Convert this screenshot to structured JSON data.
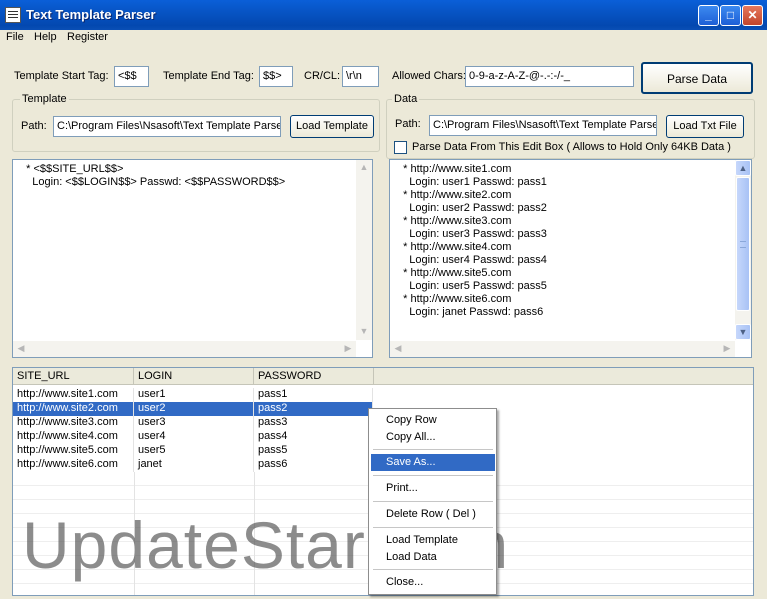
{
  "window": {
    "title": "Text Template Parser"
  },
  "menu": [
    "File",
    "Help",
    "Register"
  ],
  "toolbar": {
    "start_tag_label": "Template Start Tag:",
    "start_tag_value": "<$$",
    "end_tag_label": "Template End Tag:",
    "end_tag_value": "$$>",
    "crcl_label": "CR/CL:",
    "crcl_value": "\\r\\n",
    "allowed_label": "Allowed Chars:",
    "allowed_value": "0-9-a-z-A-Z-@-.-:-/-_",
    "parse_button": "Parse Data"
  },
  "template_panel": {
    "group_label": "Template",
    "path_label": "Path:",
    "path_value": "C:\\Program Files\\Nsasoft\\Text Template Parse",
    "load_button": "Load Template",
    "lines": [
      "   * <$$SITE_URL$$>",
      "     Login: <$$LOGIN$$> Passwd: <$$PASSWORD$$>"
    ]
  },
  "data_panel": {
    "group_label": "Data",
    "path_label": "Path:",
    "path_value": "C:\\Program Files\\Nsasoft\\Text Template Parse",
    "load_button": "Load Txt File",
    "checkbox_label": "Parse Data From This Edit Box ( Allows to Hold Only 64KB Data )",
    "checkbox_checked": false,
    "lines": [
      "   * http://www.site1.com",
      "     Login: user1 Passwd: pass1",
      "   * http://www.site2.com",
      "     Login: user2 Passwd: pass2",
      "   * http://www.site3.com",
      "     Login: user3 Passwd: pass3",
      "   * http://www.site4.com",
      "     Login: user4 Passwd: pass4",
      "   * http://www.site5.com",
      "     Login: user5 Passwd: pass5",
      "   * http://www.site6.com",
      "     Login: janet Passwd: pass6"
    ]
  },
  "results": {
    "columns": [
      "SITE_URL",
      "LOGIN",
      "PASSWORD"
    ],
    "rows": [
      [
        "http://www.site1.com",
        "user1",
        "pass1"
      ],
      [
        "http://www.site2.com",
        "user2",
        "pass2"
      ],
      [
        "http://www.site3.com",
        "user3",
        "pass3"
      ],
      [
        "http://www.site4.com",
        "user4",
        "pass4"
      ],
      [
        "http://www.site5.com",
        "user5",
        "pass5"
      ],
      [
        "http://www.site6.com",
        "janet",
        "pass6"
      ]
    ],
    "selected_row": 1
  },
  "context_menu": {
    "items": [
      "Copy Row",
      "Copy All...",
      "Save As...",
      "Print...",
      "Delete Row ( Del )",
      "Load Template",
      "Load Data",
      "Close..."
    ],
    "highlighted": "Save As..."
  },
  "watermark": "UpdateStar.com",
  "colors": {
    "titlebar": "#0554c8",
    "selection": "#316ac5",
    "face": "#ece9d8"
  }
}
